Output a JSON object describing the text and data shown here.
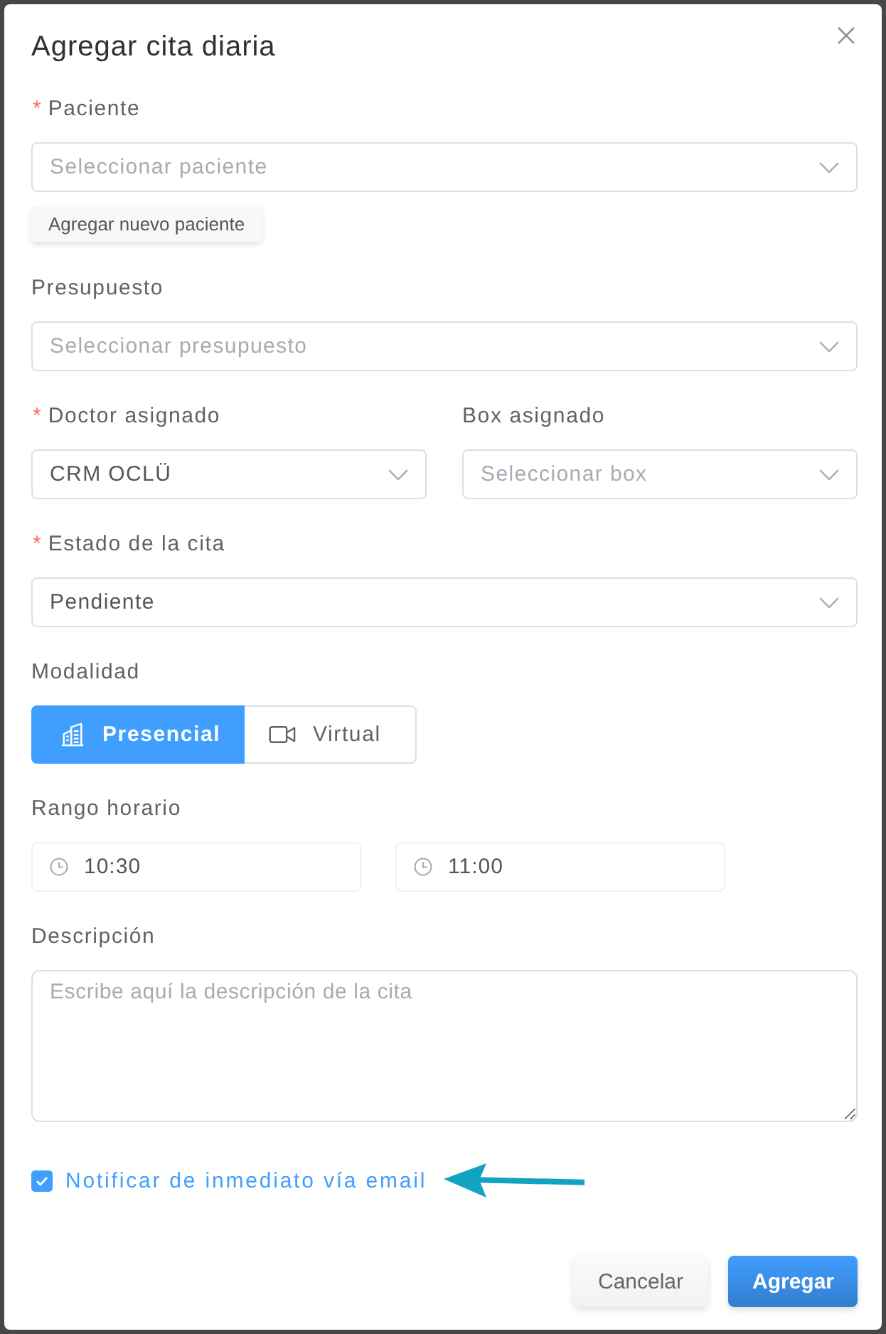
{
  "dialog": {
    "title": "Agregar cita diaria"
  },
  "form": [
    {
      "kind": "select",
      "label": "Paciente",
      "required_mark": "*",
      "placeholder": "Seleccionar paciente",
      "action": "Agregar nuevo paciente"
    },
    {
      "kind": "select",
      "label": "Presupuesto",
      "placeholder": "Seleccionar presupuesto"
    },
    {
      "kind": "row",
      "fields": [
        {
          "label": "Doctor asignado",
          "required_mark": "*",
          "value": "CRM OCLÜ"
        },
        {
          "label": "Box asignado",
          "placeholder": "Seleccionar box"
        }
      ]
    },
    {
      "kind": "select",
      "label": "Estado de la cita",
      "required_mark": "*",
      "value": "Pendiente"
    },
    {
      "kind": "segmented",
      "label": "Modalidad",
      "options": [
        {
          "label": "Presencial",
          "selected": true
        },
        {
          "label": "Virtual",
          "selected": false
        }
      ]
    },
    {
      "kind": "timerange",
      "label": "Rango horario",
      "start": "10:30",
      "end": "11:00"
    },
    {
      "kind": "textarea",
      "label": "Descripción",
      "placeholder": "Escribe aquí la descripción de la cita"
    },
    {
      "kind": "checkbox",
      "label": "Notificar de inmediato vía email",
      "checked": true
    }
  ],
  "buttons": [
    {
      "label": "Cancelar",
      "kind": "secondary"
    },
    {
      "label": "Agregar",
      "kind": "primary"
    }
  ]
}
